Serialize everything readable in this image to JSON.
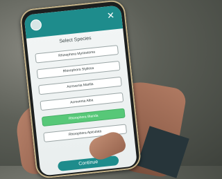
{
  "app": {
    "title": "Select Species",
    "close_glyph": "✕",
    "accent_color": "#1e8c8c",
    "selected_color": "#57c878"
  },
  "species": [
    {
      "caption": "",
      "name": "Rhinophora Myriostoma",
      "selected": false
    },
    {
      "caption": "",
      "name": "Rhinophora Styliosa",
      "selected": false
    },
    {
      "caption": "",
      "name": "Acrovenia Marilla",
      "selected": false
    },
    {
      "caption": "",
      "name": "Acrovenia Alba",
      "selected": false
    },
    {
      "caption": "",
      "name": "Rhinophora Blanda",
      "selected": true
    },
    {
      "caption": "",
      "name": "Rhinophora Apiculata",
      "selected": false
    }
  ],
  "actions": {
    "continue_label": "Continue"
  }
}
